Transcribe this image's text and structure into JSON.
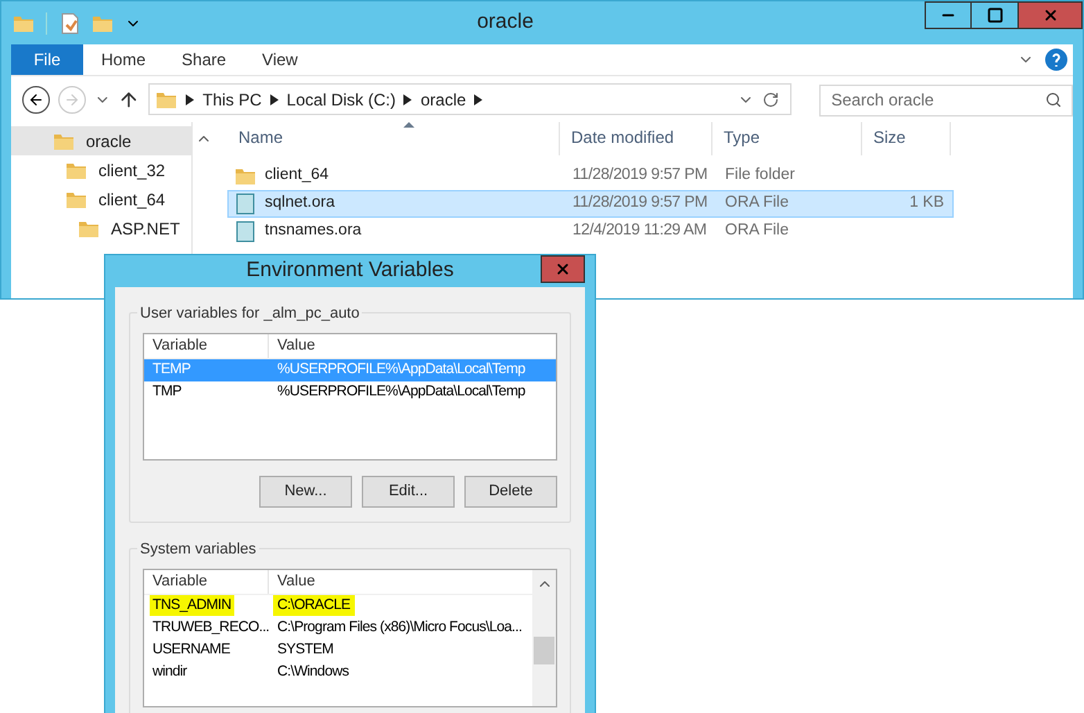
{
  "explorer": {
    "title": "oracle",
    "ribbon_tabs": [
      {
        "label": "File",
        "kind": "file"
      },
      {
        "label": "Home",
        "kind": "tab"
      },
      {
        "label": "Share",
        "kind": "tab"
      },
      {
        "label": "View",
        "kind": "tab"
      }
    ],
    "breadcrumbs": [
      "This PC",
      "Local Disk (C:)",
      "oracle"
    ],
    "search": {
      "placeholder": "Search oracle"
    },
    "nav_tree": [
      {
        "label": "oracle",
        "selected": true,
        "children": [
          {
            "label": "client_32",
            "selected": false
          },
          {
            "label": "client_64",
            "selected": false,
            "children": [
              {
                "label": "ASP.NET",
                "selected": false
              }
            ]
          }
        ]
      }
    ],
    "columns": [
      "Name",
      "Date modified",
      "Type",
      "Size"
    ],
    "files": [
      {
        "kind": "folder",
        "name": "client_64",
        "date": "11/28/2019 9:57 PM",
        "type": "File folder",
        "selected": false
      },
      {
        "kind": "file",
        "name": "sqlnet.ora",
        "date": "11/28/2019 9:57 PM",
        "type": "ORA File",
        "size": "1 KB",
        "selected": true
      },
      {
        "kind": "file",
        "name": "tnsnames.ora",
        "date": "12/4/2019 11:29 AM",
        "type": "ORA File",
        "selected": false
      }
    ]
  },
  "dialog": {
    "title": "Environment Variables",
    "user_group": {
      "label": "User variables for _alm_pc_auto",
      "columns": [
        "Variable",
        "Value"
      ],
      "rows": [
        {
          "variable": "TEMP",
          "value": "%USERPROFILE%\\AppData\\Local\\Temp",
          "selected": true,
          "highlighted": false
        },
        {
          "variable": "TMP",
          "value": "%USERPROFILE%\\AppData\\Local\\Temp",
          "selected": false,
          "highlighted": false
        }
      ]
    },
    "buttons": [
      "New...",
      "Edit...",
      "Delete"
    ],
    "system_group": {
      "label": "System variables",
      "columns": [
        "Variable",
        "Value"
      ],
      "rows": [
        {
          "variable": "TNS_ADMIN",
          "value": "C:\\ORACLE",
          "selected": false,
          "highlighted": true
        },
        {
          "variable": "TRUWEB_RECO...",
          "value": "C:\\Program Files (x86)\\Micro Focus\\Loa...",
          "selected": false,
          "highlighted": false
        },
        {
          "variable": "USERNAME",
          "value": "SYSTEM",
          "selected": false,
          "highlighted": false
        },
        {
          "variable": "windir",
          "value": "C:\\Windows",
          "selected": false,
          "highlighted": false
        }
      ]
    }
  }
}
